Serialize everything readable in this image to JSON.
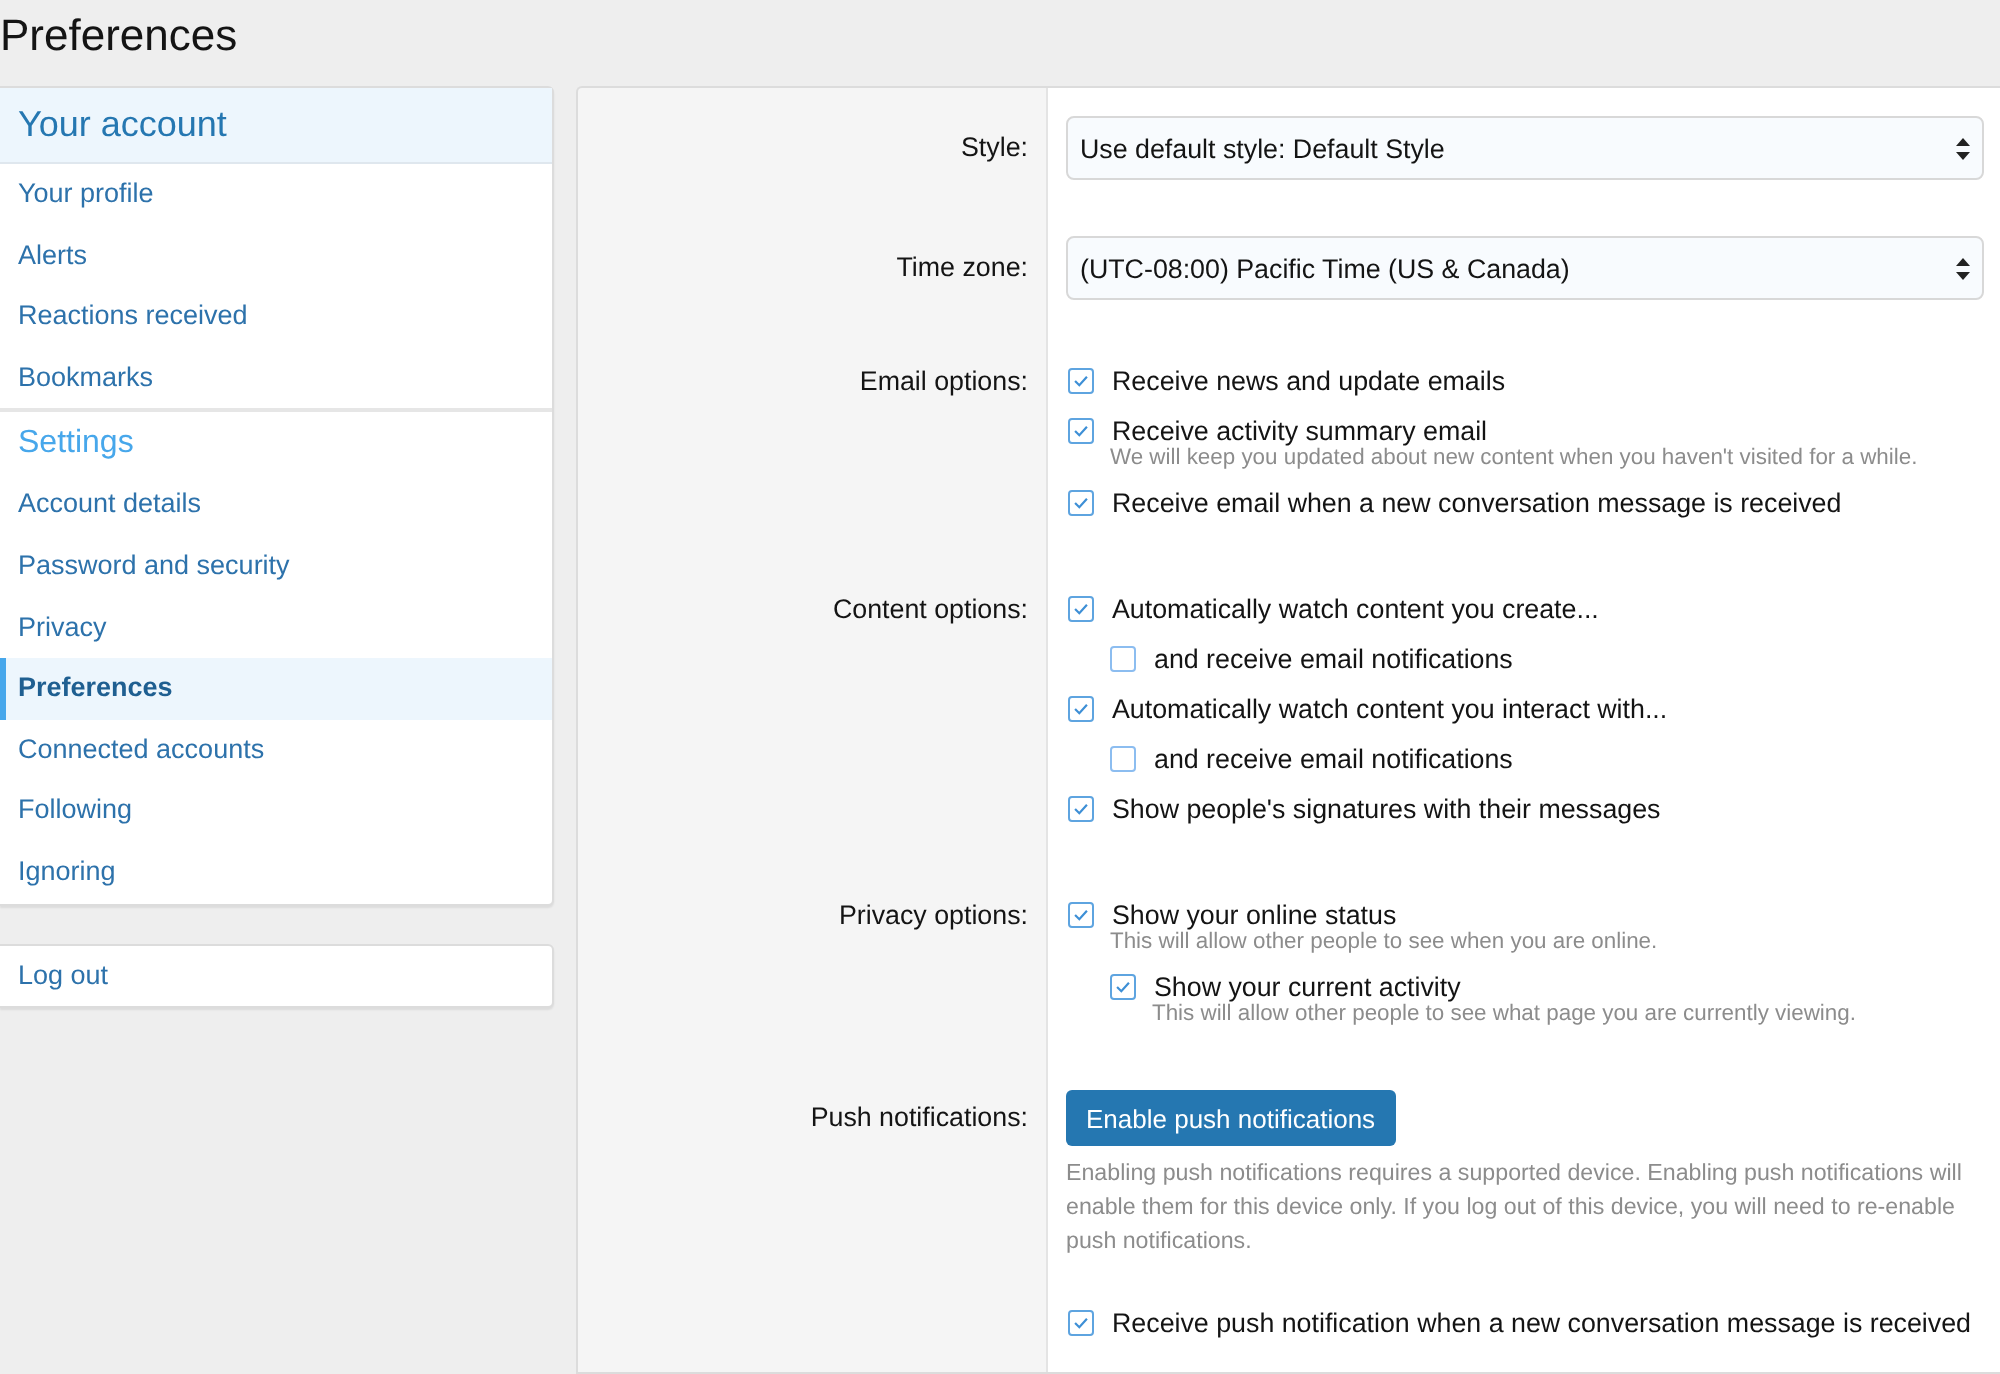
{
  "page": {
    "title": "Preferences"
  },
  "sidebar": {
    "sections": [
      {
        "heading": "Your account",
        "kind": "primary",
        "items": [
          {
            "label": "Your profile",
            "selected": false
          },
          {
            "label": "Alerts",
            "selected": false
          },
          {
            "label": "Reactions received",
            "selected": false
          },
          {
            "label": "Bookmarks",
            "selected": false
          }
        ]
      },
      {
        "heading": "Settings",
        "kind": "secondary",
        "items": [
          {
            "label": "Account details",
            "selected": false
          },
          {
            "label": "Password and security",
            "selected": false
          },
          {
            "label": "Privacy",
            "selected": false
          },
          {
            "label": "Preferences",
            "selected": true
          },
          {
            "label": "Connected accounts",
            "selected": false
          },
          {
            "label": "Following",
            "selected": false
          },
          {
            "label": "Ignoring",
            "selected": false
          }
        ]
      }
    ],
    "logout": "Log out"
  },
  "form": {
    "rows": [
      {
        "label": "Style:",
        "kind": "select",
        "value": "Use default style: Default Style"
      },
      {
        "label": "Time zone:",
        "kind": "select",
        "value": "(UTC-08:00) Pacific Time (US & Canada)"
      },
      {
        "label": "Email options:",
        "kind": "checks",
        "options": [
          {
            "text": "Receive news and update emails",
            "checked": true
          },
          {
            "text": "Receive activity summary email",
            "checked": true,
            "hint": "We will keep you updated about new content when you haven't visited for a while."
          },
          {
            "text": "Receive email when a new conversation message is received",
            "checked": true
          }
        ]
      },
      {
        "label": "Content options:",
        "kind": "checks",
        "options": [
          {
            "text": "Automatically watch content you create...",
            "checked": true,
            "children": [
              {
                "text": "and receive email notifications",
                "checked": false
              }
            ]
          },
          {
            "text": "Automatically watch content you interact with...",
            "checked": true,
            "children": [
              {
                "text": "and receive email notifications",
                "checked": false
              }
            ]
          },
          {
            "text": "Show people's signatures with their messages",
            "checked": true
          }
        ]
      },
      {
        "label": "Privacy options:",
        "kind": "checks",
        "options": [
          {
            "text": "Show your online status",
            "checked": true,
            "hint": "This will allow other people to see when you are online.",
            "children": [
              {
                "text": "Show your current activity",
                "checked": true,
                "hint": "This will allow other people to see what page you are currently viewing."
              }
            ]
          }
        ]
      },
      {
        "label": "Push notifications:",
        "kind": "push",
        "button": "Enable push notifications",
        "hint": "Enabling push notifications requires a supported device. Enabling push notifications will enable them for this device only. If you log out of this device, you will need to re-enable push notifications.",
        "options": [
          {
            "text": "Receive push notification when a new conversation message is received",
            "checked": true
          }
        ]
      }
    ]
  }
}
